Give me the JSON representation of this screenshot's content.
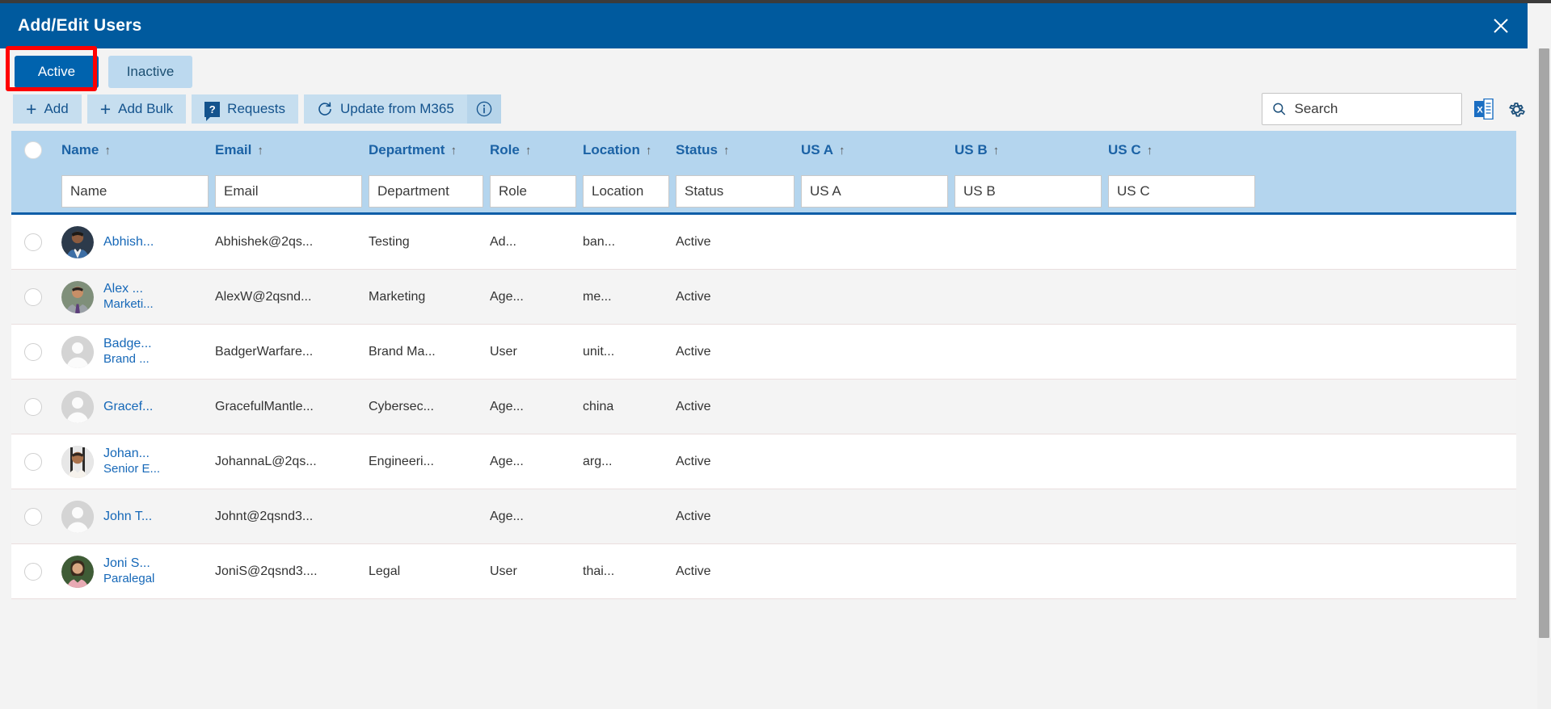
{
  "window": {
    "title": "Add/Edit Users",
    "close_label": "✕",
    "accent_color": "#005a9e",
    "header_row_color": "#b4d5ee",
    "link_color": "#1668b8"
  },
  "tabs": [
    {
      "label": "Active",
      "selected": true
    },
    {
      "label": "Inactive",
      "selected": false
    }
  ],
  "annotation": {
    "target": "Active",
    "color": "#ff0000"
  },
  "toolbar": {
    "add_label": "Add",
    "add_bulk_label": "Add Bulk",
    "requests_label": "Requests",
    "requests_icon": "question-badge-icon",
    "update_label": "Update from M365",
    "update_icon": "refresh-icon",
    "info_icon": "info-circle-icon",
    "plus_icon": "plus-icon"
  },
  "search": {
    "placeholder": "Search",
    "value": "",
    "icon": "search-icon"
  },
  "actions": {
    "export_excel_icon": "excel-export-icon",
    "settings_icon": "gear-icon"
  },
  "grid": {
    "select_all": "select-all-circle",
    "columns": [
      {
        "key": "name",
        "label": "Name",
        "sort": "↑",
        "filter_placeholder": "Name"
      },
      {
        "key": "email",
        "label": "Email",
        "sort": "↑",
        "filter_placeholder": "Email"
      },
      {
        "key": "dept",
        "label": "Department",
        "sort": "↑",
        "filter_placeholder": "Department"
      },
      {
        "key": "role",
        "label": "Role",
        "sort": "↑",
        "filter_placeholder": "Role"
      },
      {
        "key": "loc",
        "label": "Location",
        "sort": "↑",
        "filter_placeholder": "Location"
      },
      {
        "key": "stat",
        "label": "Status",
        "sort": "↑",
        "filter_placeholder": "Status"
      },
      {
        "key": "usa",
        "label": "US A",
        "sort": "↑",
        "filter_placeholder": "US A"
      },
      {
        "key": "usb",
        "label": "US B",
        "sort": "↑",
        "filter_placeholder": "US B"
      },
      {
        "key": "usc",
        "label": "US C",
        "sort": "↑",
        "filter_placeholder": "US C"
      }
    ],
    "rows": [
      {
        "name": "Abhish...",
        "subtitle": "",
        "avatar": "photo-male-1",
        "email": "Abhishek@2qs...",
        "dept": "Testing",
        "role": "Ad...",
        "loc": "ban...",
        "stat": "Active",
        "usa": "",
        "usb": "",
        "usc": ""
      },
      {
        "name": "Alex ...",
        "subtitle": "Marketi...",
        "avatar": "photo-male-2",
        "email": "AlexW@2qsnd...",
        "dept": "Marketing",
        "role": "Age...",
        "loc": "me...",
        "stat": "Active",
        "usa": "",
        "usb": "",
        "usc": ""
      },
      {
        "name": "Badge...",
        "subtitle": "Brand ...",
        "avatar": "placeholder",
        "email": "BadgerWarfare...",
        "dept": "Brand Ma...",
        "role": "User",
        "loc": "unit...",
        "stat": "Active",
        "usa": "",
        "usb": "",
        "usc": ""
      },
      {
        "name": "Gracef...",
        "subtitle": "",
        "avatar": "placeholder",
        "email": "GracefulMantle...",
        "dept": "Cybersec...",
        "role": "Age...",
        "loc": "china",
        "stat": "Active",
        "usa": "",
        "usb": "",
        "usc": ""
      },
      {
        "name": "Johan...",
        "subtitle": "Senior E...",
        "avatar": "photo-male-3",
        "email": "JohannaL@2qs...",
        "dept": "Engineeri...",
        "role": "Age...",
        "loc": "arg...",
        "stat": "Active",
        "usa": "",
        "usb": "",
        "usc": ""
      },
      {
        "name": "John T...",
        "subtitle": "",
        "avatar": "placeholder",
        "email": "Johnt@2qsnd3...",
        "dept": "",
        "role": "Age...",
        "loc": "",
        "stat": "Active",
        "usa": "",
        "usb": "",
        "usc": ""
      },
      {
        "name": "Joni S...",
        "subtitle": "Paralegal",
        "avatar": "photo-female-1",
        "email": "JoniS@2qsnd3....",
        "dept": "Legal",
        "role": "User",
        "loc": "thai...",
        "stat": "Active",
        "usa": "",
        "usb": "",
        "usc": ""
      }
    ]
  }
}
